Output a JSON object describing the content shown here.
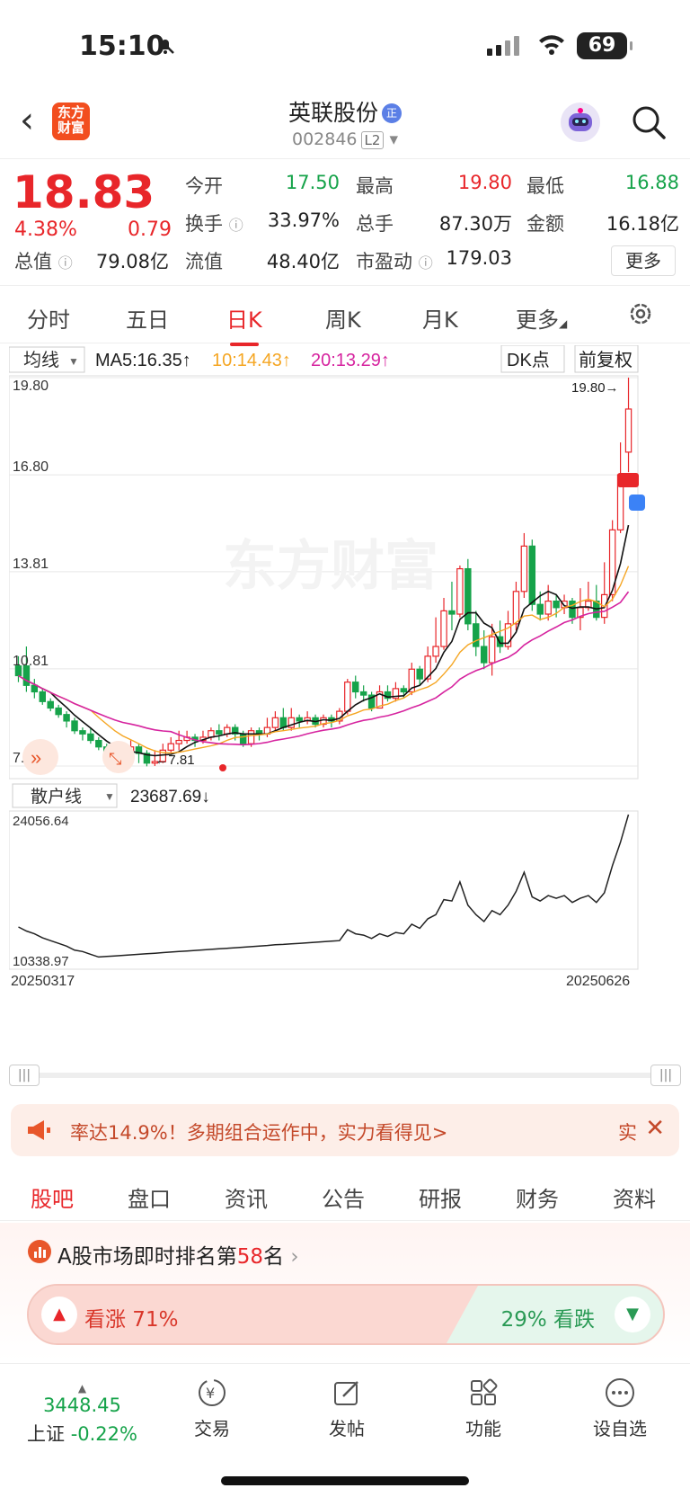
{
  "status": {
    "time": "15:10",
    "battery": "69"
  },
  "header": {
    "name": "英联股份",
    "badge": "正",
    "code": "002846",
    "level": "L2"
  },
  "quote": {
    "price": "18.83",
    "pct": "4.38%",
    "chg": "0.79",
    "fields": [
      {
        "label": "今开",
        "value": "17.50",
        "color": "#16a34a"
      },
      {
        "label": "最高",
        "value": "19.80",
        "color": "#e8262a"
      },
      {
        "label": "最低",
        "value": "16.88",
        "color": "#16a34a"
      },
      {
        "label": "换手",
        "value": "33.97%",
        "color": "#222"
      },
      {
        "label": "总手",
        "value": "87.30万",
        "color": "#222"
      },
      {
        "label": "金额",
        "value": "16.18亿",
        "color": "#222"
      },
      {
        "label": "总值",
        "value": "79.08亿",
        "color": "#222"
      },
      {
        "label": "流值",
        "value": "48.40亿",
        "color": "#222"
      },
      {
        "label": "市盈动",
        "value": "179.03",
        "color": "#222"
      }
    ],
    "more": "更多"
  },
  "ktabs": [
    "分时",
    "五日",
    "日K",
    "周K",
    "月K",
    "更多"
  ],
  "ma": {
    "selector": "均线",
    "ma5": "MA5:16.35↑",
    "ma10": "10:14.43↑",
    "ma20": "20:13.29↑",
    "dk": "DK点",
    "adj": "前复权"
  },
  "chart_data": {
    "type": "candlestick",
    "y_ticks": [
      "19.80",
      "16.80",
      "13.81",
      "10.81",
      "7.81"
    ],
    "high_label": "19.80→",
    "low_label": "←7.81",
    "candles": [
      [
        10.9,
        10.6,
        11.2,
        10.4
      ],
      [
        10.9,
        10.3,
        11.5,
        10.1
      ],
      [
        10.3,
        10.1,
        10.5,
        9.9
      ],
      [
        10.1,
        9.8,
        10.2,
        9.7
      ],
      [
        9.8,
        9.6,
        9.9,
        9.5
      ],
      [
        9.6,
        9.4,
        9.7,
        9.3
      ],
      [
        9.4,
        9.2,
        9.5,
        9.0
      ],
      [
        9.2,
        8.9,
        9.3,
        8.8
      ],
      [
        8.9,
        8.8,
        9.0,
        8.6
      ],
      [
        8.8,
        8.6,
        9.0,
        8.5
      ],
      [
        8.6,
        8.4,
        8.7,
        8.3
      ],
      [
        8.4,
        8.2,
        8.5,
        8.1
      ],
      [
        8.2,
        8.1,
        8.3,
        8.0
      ],
      [
        8.1,
        8.2,
        8.4,
        8.0
      ],
      [
        8.2,
        8.4,
        8.6,
        8.1
      ],
      [
        8.4,
        8.2,
        8.5,
        7.9
      ],
      [
        8.2,
        7.9,
        8.3,
        7.8
      ],
      [
        7.9,
        7.95,
        8.3,
        7.81
      ],
      [
        7.95,
        8.3,
        8.5,
        7.9
      ],
      [
        8.3,
        8.5,
        8.7,
        8.2
      ],
      [
        8.5,
        8.6,
        8.9,
        8.3
      ],
      [
        8.6,
        8.7,
        8.9,
        8.5
      ],
      [
        8.7,
        8.6,
        8.8,
        8.4
      ],
      [
        8.6,
        8.7,
        8.9,
        8.5
      ],
      [
        8.7,
        8.9,
        9.0,
        8.6
      ],
      [
        8.9,
        8.8,
        9.1,
        8.6
      ],
      [
        8.8,
        9.0,
        9.1,
        8.7
      ],
      [
        9.0,
        8.8,
        9.1,
        8.6
      ],
      [
        8.8,
        8.5,
        8.9,
        8.4
      ],
      [
        8.5,
        8.9,
        9.0,
        8.4
      ],
      [
        8.9,
        8.8,
        9.0,
        8.6
      ],
      [
        8.8,
        9.0,
        9.3,
        8.7
      ],
      [
        9.0,
        9.3,
        9.5,
        8.9
      ],
      [
        9.3,
        9.0,
        9.6,
        8.9
      ],
      [
        9.0,
        9.3,
        9.6,
        8.9
      ],
      [
        9.3,
        9.2,
        9.4,
        9.0
      ],
      [
        9.2,
        9.3,
        9.5,
        9.1
      ],
      [
        9.3,
        9.1,
        9.4,
        9.0
      ],
      [
        9.1,
        9.3,
        9.4,
        9.0
      ],
      [
        9.3,
        9.2,
        9.4,
        9.0
      ],
      [
        9.2,
        9.5,
        9.6,
        9.1
      ],
      [
        9.5,
        10.4,
        10.5,
        9.4
      ],
      [
        10.4,
        10.1,
        10.6,
        9.9
      ],
      [
        10.1,
        10.0,
        10.3,
        9.8
      ],
      [
        10.0,
        9.6,
        10.1,
        9.5
      ],
      [
        9.6,
        10.1,
        10.3,
        9.6
      ],
      [
        10.1,
        9.9,
        10.3,
        9.8
      ],
      [
        9.9,
        10.2,
        10.4,
        9.8
      ],
      [
        10.2,
        10.1,
        10.3,
        9.9
      ],
      [
        10.1,
        10.8,
        11.0,
        10.0
      ],
      [
        10.8,
        10.5,
        10.9,
        10.3
      ],
      [
        10.5,
        11.2,
        11.5,
        10.4
      ],
      [
        11.2,
        11.5,
        12.4,
        11.0
      ],
      [
        11.5,
        12.6,
        13.0,
        11.4
      ],
      [
        12.6,
        12.5,
        13.5,
        12.0
      ],
      [
        12.5,
        13.9,
        14.0,
        12.4
      ],
      [
        13.9,
        12.2,
        14.2,
        12.0
      ],
      [
        12.2,
        11.5,
        12.6,
        11.2
      ],
      [
        11.5,
        11.0,
        12.0,
        10.8
      ],
      [
        11.0,
        11.8,
        12.2,
        10.6
      ],
      [
        11.8,
        11.5,
        12.3,
        11.3
      ],
      [
        11.5,
        12.2,
        12.6,
        11.4
      ],
      [
        12.2,
        13.2,
        13.5,
        12.0
      ],
      [
        13.2,
        14.6,
        15.0,
        13.0
      ],
      [
        14.6,
        12.8,
        14.8,
        12.6
      ],
      [
        12.8,
        12.5,
        13.2,
        12.3
      ],
      [
        12.5,
        12.9,
        13.4,
        12.3
      ],
      [
        12.9,
        12.7,
        13.1,
        12.4
      ],
      [
        12.7,
        12.9,
        13.1,
        12.5
      ],
      [
        12.9,
        12.4,
        13.0,
        12.2
      ],
      [
        12.4,
        12.7,
        13.3,
        12.0
      ],
      [
        12.7,
        12.9,
        13.5,
        12.6
      ],
      [
        12.9,
        12.4,
        13.4,
        12.3
      ],
      [
        12.4,
        13.1,
        14.1,
        12.2
      ],
      [
        13.1,
        15.1,
        15.4,
        12.9
      ],
      [
        15.1,
        16.8,
        17.8,
        15.0
      ],
      [
        17.5,
        18.83,
        19.8,
        16.88
      ]
    ],
    "retail_indicator": {
      "label": "散户线",
      "current": "23687.69↓",
      "max": "24056.64",
      "min": "10338.97",
      "start_date": "20250317",
      "end_date": "20250626"
    }
  },
  "ad": {
    "text": "率达14.9%！多期组合运作中，实力看得见>",
    "tag": "实"
  },
  "btabs": [
    "股吧",
    "盘口",
    "资讯",
    "公告",
    "研报",
    "财务",
    "资料"
  ],
  "rank": {
    "prefix": "A股市场即时排名第",
    "num": "58",
    "suffix": "名"
  },
  "vote": {
    "up": "看涨 71%",
    "down": "29% 看跌"
  },
  "bnav": {
    "index_value": "3448.45",
    "index_name": "上证",
    "index_chg": "-0.22%",
    "items": [
      "交易",
      "发帖",
      "功能",
      "设自选"
    ]
  }
}
